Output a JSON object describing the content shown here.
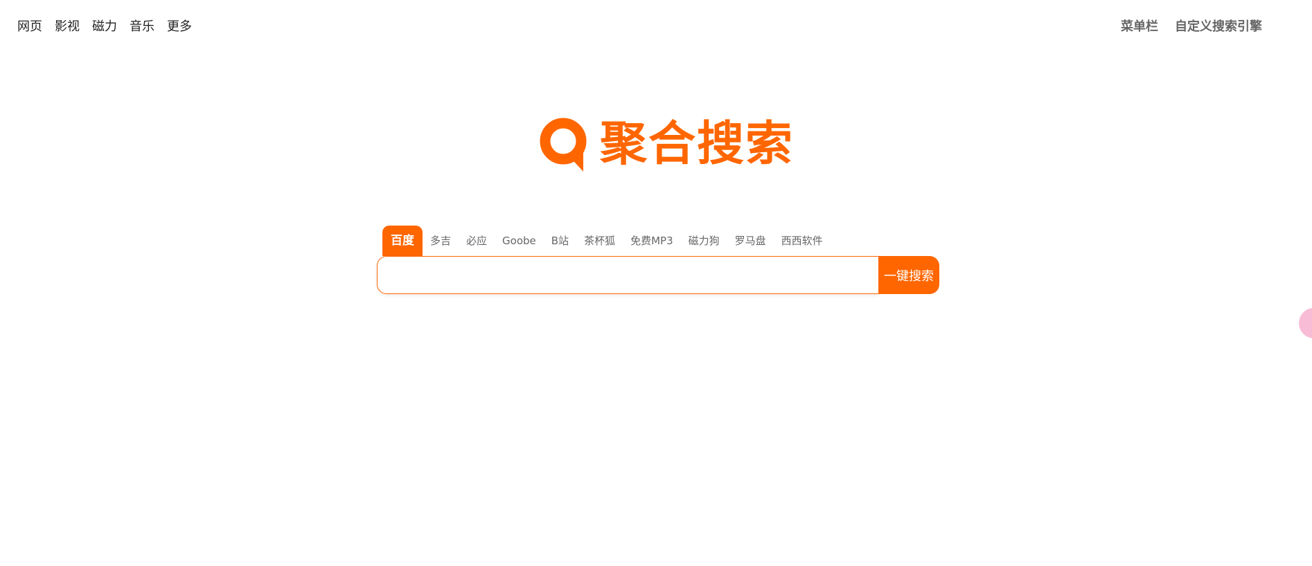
{
  "top_nav": {
    "items": [
      {
        "label": "网页"
      },
      {
        "label": "影视"
      },
      {
        "label": "磁力"
      },
      {
        "label": "音乐"
      },
      {
        "label": "更多"
      }
    ]
  },
  "top_right": {
    "menu_label": "菜单栏",
    "custom_engine_label": "自定义搜索引擎"
  },
  "logo": {
    "text": "聚合搜索",
    "icon": "search-logo-icon",
    "color": "#ff6600"
  },
  "tabs": {
    "items": [
      {
        "label": "百度",
        "active": true
      },
      {
        "label": "多吉"
      },
      {
        "label": "必应"
      },
      {
        "label": "Goobe"
      },
      {
        "label": "B站"
      },
      {
        "label": "茶杯狐"
      },
      {
        "label": "免费MP3"
      },
      {
        "label": "磁力狗"
      },
      {
        "label": "罗马盘"
      },
      {
        "label": "西西软件"
      }
    ]
  },
  "search": {
    "value": "",
    "placeholder": "",
    "button_label": "一键搜索"
  },
  "theme": {
    "accent": "#ff6600",
    "widget": "#f8bcd6"
  }
}
